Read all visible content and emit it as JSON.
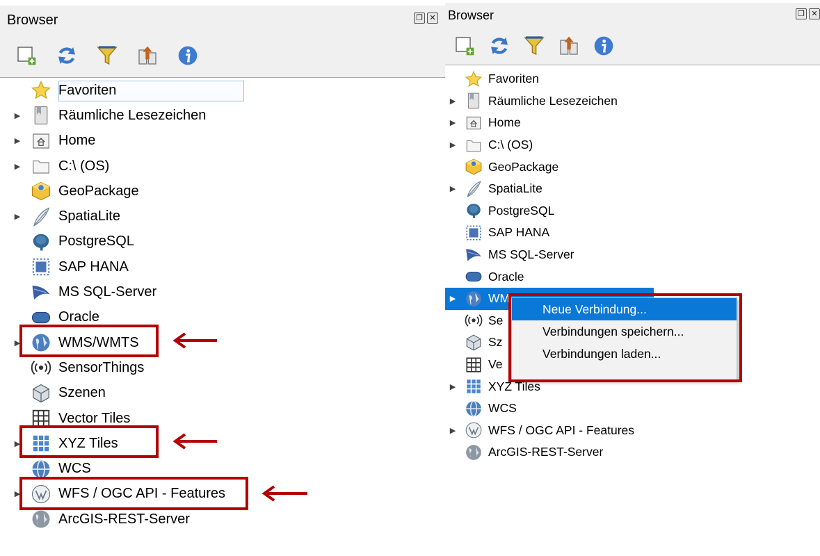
{
  "colors": {
    "accent": "#0a78d7",
    "annotation_red": "#b30000",
    "titlebar": "#f0f0f0"
  },
  "left": {
    "title": "Browser",
    "window_buttons": [
      "restore-icon",
      "close-icon"
    ],
    "toolbar": [
      "add-layer-icon",
      "refresh-icon",
      "filter-icon",
      "collapse-all-icon",
      "info-icon"
    ],
    "items": [
      {
        "label": "Favoriten",
        "icon": "star-icon",
        "expandable": false
      },
      {
        "label": "Räumliche Lesezeichen",
        "icon": "bookmarks-icon",
        "expandable": true
      },
      {
        "label": "Home",
        "icon": "home-folder-icon",
        "expandable": true
      },
      {
        "label": "C:\\ (OS)",
        "icon": "folder-icon",
        "expandable": true
      },
      {
        "label": "GeoPackage",
        "icon": "geopackage-icon",
        "expandable": false
      },
      {
        "label": "SpatiaLite",
        "icon": "feather-icon",
        "expandable": true
      },
      {
        "label": "PostgreSQL",
        "icon": "elephant-icon",
        "expandable": false
      },
      {
        "label": "SAP HANA",
        "icon": "hana-icon",
        "expandable": false
      },
      {
        "label": "MS SQL-Server",
        "icon": "mssql-icon",
        "expandable": false
      },
      {
        "label": "Oracle",
        "icon": "oracle-icon",
        "expandable": false
      },
      {
        "label": "WMS/WMTS",
        "icon": "globe-icon",
        "expandable": true
      },
      {
        "label": "SensorThings",
        "icon": "sensor-icon",
        "expandable": false
      },
      {
        "label": "Szenen",
        "icon": "cube-icon",
        "expandable": false
      },
      {
        "label": "Vector Tiles",
        "icon": "vector-tiles-icon",
        "expandable": false
      },
      {
        "label": "XYZ Tiles",
        "icon": "xyz-tiles-icon",
        "expandable": true
      },
      {
        "label": "WCS",
        "icon": "wcs-globe-icon",
        "expandable": false
      },
      {
        "label": "WFS / OGC API - Features",
        "icon": "wfs-icon",
        "expandable": true
      },
      {
        "label": "ArcGIS-REST-Server",
        "icon": "arcgis-globe-icon",
        "expandable": false
      }
    ]
  },
  "right": {
    "title": "Browser",
    "window_buttons": [
      "restore-icon",
      "close-icon"
    ],
    "toolbar": [
      "add-layer-icon",
      "refresh-icon",
      "filter-icon",
      "collapse-all-icon",
      "info-icon"
    ],
    "items": [
      {
        "label": "Favoriten",
        "icon": "star-icon",
        "expandable": false
      },
      {
        "label": "Räumliche Lesezeichen",
        "icon": "bookmarks-icon",
        "expandable": true
      },
      {
        "label": "Home",
        "icon": "home-folder-icon",
        "expandable": true
      },
      {
        "label": "C:\\ (OS)",
        "icon": "folder-icon",
        "expandable": true
      },
      {
        "label": "GeoPackage",
        "icon": "geopackage-icon",
        "expandable": false
      },
      {
        "label": "SpatiaLite",
        "icon": "feather-icon",
        "expandable": true
      },
      {
        "label": "PostgreSQL",
        "icon": "elephant-icon",
        "expandable": false
      },
      {
        "label": "SAP HANA",
        "icon": "hana-icon",
        "expandable": false
      },
      {
        "label": "MS SQL-Server",
        "icon": "mssql-icon",
        "expandable": false
      },
      {
        "label": "Oracle",
        "icon": "oracle-icon",
        "expandable": false
      },
      {
        "label": "WM",
        "icon": "globe-icon",
        "expandable": true,
        "selected": true
      },
      {
        "label": "Se",
        "icon": "sensor-icon",
        "expandable": false
      },
      {
        "label": "Sz",
        "icon": "cube-icon",
        "expandable": false
      },
      {
        "label": "Ve",
        "icon": "vector-tiles-icon",
        "expandable": false
      },
      {
        "label": "XYZ Tiles",
        "icon": "xyz-tiles-icon",
        "expandable": true
      },
      {
        "label": "WCS",
        "icon": "wcs-globe-icon",
        "expandable": false
      },
      {
        "label": "WFS / OGC API - Features",
        "icon": "wfs-icon",
        "expandable": true
      },
      {
        "label": "ArcGIS-REST-Server",
        "icon": "arcgis-globe-icon",
        "expandable": false
      }
    ],
    "context_menu": [
      {
        "label": "Neue Verbindung...",
        "highlighted": true
      },
      {
        "label": "Verbindungen speichern...",
        "highlighted": false
      },
      {
        "label": "Verbindungen laden...",
        "highlighted": false
      }
    ]
  }
}
